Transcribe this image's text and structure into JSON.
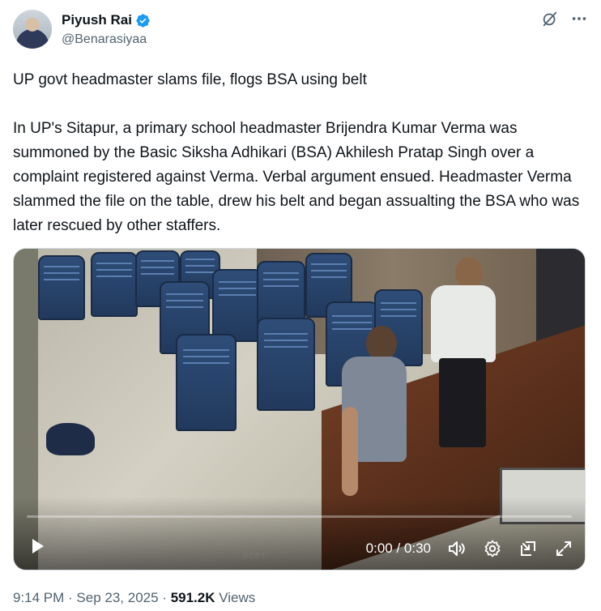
{
  "author": {
    "display_name": "Piyush Rai",
    "handle": "@Benarasiyaa",
    "verified": true
  },
  "header_actions": {
    "grok_icon": "grok-icon",
    "more_icon": "more-icon"
  },
  "tweet": {
    "headline": "UP govt headmaster slams file, flogs BSA using belt",
    "body": "In UP's Sitapur, a primary school headmaster Brijendra Kumar Verma was summoned by the Basic Siksha Adhikari (BSA) Akhilesh Pratap Singh over a complaint registered against Verma. Verbal argument ensued. Headmaster Verma slammed the file on the table, drew his belt and began assualting the BSA who was later rescued by other staffers."
  },
  "video": {
    "time_display": "0:00 / 0:30",
    "progress": 0,
    "watermark": "acer",
    "controls": [
      "play-icon",
      "volume-icon",
      "settings-icon",
      "pip-icon",
      "fullscreen-icon"
    ]
  },
  "meta": {
    "time": "9:14 PM",
    "separator1": " · ",
    "date": "Sep 23, 2025",
    "separator2": " · ",
    "views_count": "591.2K",
    "views_label": " Views"
  },
  "colors": {
    "verified": "#1d9bf0",
    "text_primary": "#0f1419",
    "text_secondary": "#536471"
  }
}
